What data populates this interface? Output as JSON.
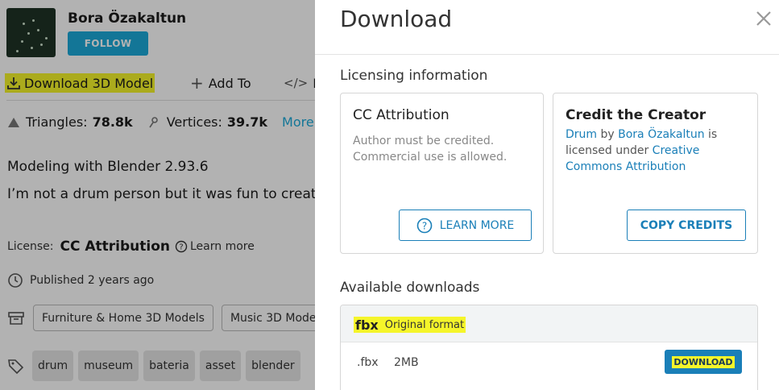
{
  "background": {
    "author": {
      "name": "Bora Özakaltun",
      "follow_label": "FOLLOW"
    },
    "actions": {
      "download_3d_label": "Download 3D Model",
      "add_to_label": "Add To",
      "embed_label": "E"
    },
    "stats": {
      "triangles_label": "Triangles:",
      "triangles_value": "78.8k",
      "vertices_label": "Vertices:",
      "vertices_value": "39.7k",
      "more_label": "More"
    },
    "description": [
      "Modeling with Blender 2.93.6",
      "I’m not a drum person but it was fun to create."
    ],
    "license": {
      "label": "License:",
      "value": "CC Attribution",
      "learn_more": "Learn more"
    },
    "published": {
      "label": "Published",
      "time": "2 years ago"
    },
    "categories": [
      "Furniture & Home 3D Models",
      "Music 3D Mode"
    ],
    "tags": [
      "drum",
      "museum",
      "bateria",
      "asset",
      "blender"
    ]
  },
  "modal": {
    "title": "Download",
    "licensing_heading": "Licensing information",
    "cc_card": {
      "title": "CC Attribution",
      "line1": "Author must be credited.",
      "line2": "Commercial use is allowed.",
      "button": "LEARN MORE"
    },
    "credit_card": {
      "title": "Credit the Creator",
      "model_link": "Drum",
      "by": " by ",
      "author_link": "Bora Özakaltun",
      "is": " is",
      "licensed_under": "licensed under ",
      "license_link": "Creative Commons Attribution",
      "button": "COPY CREDITS"
    },
    "available_heading": "Available downloads",
    "formats": [
      {
        "name": "fbx",
        "description": "Original format",
        "ext": ".fbx",
        "size": "2MB",
        "button": "DOWNLOAD"
      }
    ]
  },
  "colors": {
    "accent": "#1a7fb8",
    "follow": "#1caad9",
    "highlight": "#f5f52a"
  }
}
